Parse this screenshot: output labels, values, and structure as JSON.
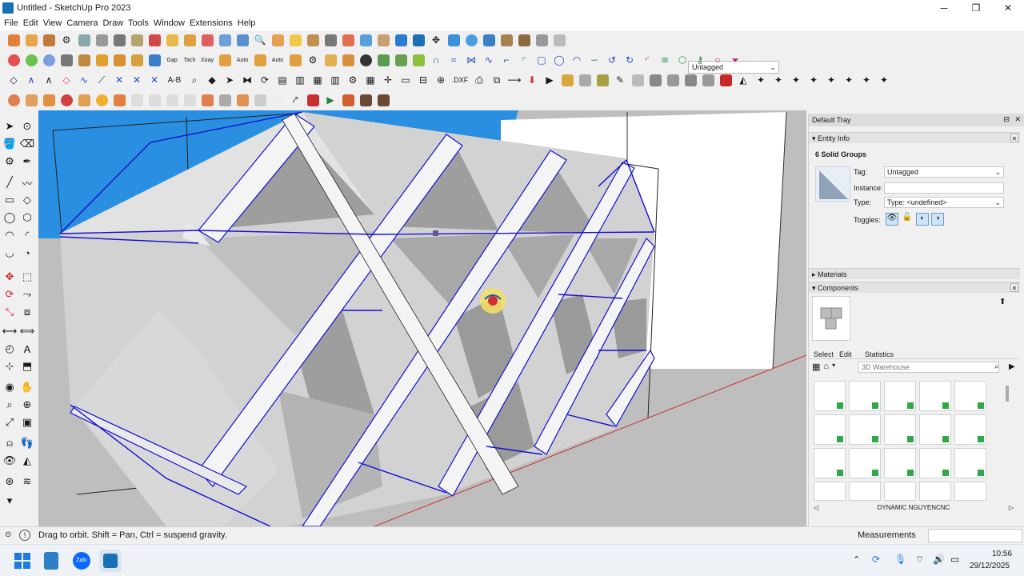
{
  "window": {
    "title": "Untitled - SketchUp Pro 2023",
    "minimize_glyph": "─",
    "maximize_glyph": "❐",
    "close_glyph": "✕"
  },
  "menu": [
    "File",
    "Edit",
    "View",
    "Camera",
    "Draw",
    "Tools",
    "Window",
    "Extensions",
    "Help"
  ],
  "toolbar": {
    "tag_dropdown_value": "Untagged",
    "row2_labels": [
      "Gạp",
      "Tach",
      "Xoay",
      "Auto",
      "Auto"
    ],
    "text_tools": [
      "A-B",
      ".DXF"
    ]
  },
  "tray": {
    "title": "Default Tray",
    "entity_info": {
      "header": "Entity Info",
      "selection": "6 Solid Groups",
      "tag_label": "Tag:",
      "tag_value": "Untagged",
      "instance_label": "Instance:",
      "instance_value": "",
      "type_label": "Type:",
      "type_value": "Type: <undefined>",
      "toggles_label": "Toggles:"
    },
    "materials": {
      "header": "Materials"
    },
    "components": {
      "header": "Components",
      "tabs": [
        "Select",
        "Edit",
        "Statistics"
      ],
      "search_placeholder": "3D Warehouse",
      "collection_name": "DYNAMIC NGUYENCNC"
    }
  },
  "status": {
    "hint": "Drag to orbit. Shift = Pan, Ctrl = suspend gravity.",
    "measurements_label": "Measurements"
  },
  "taskbar": {
    "time": "10:56",
    "date": "29/12/2025"
  },
  "colors": {
    "sky": "#2a8fe0",
    "ground": "#bebebe",
    "edge_selected": "#1010d0",
    "accent": "#1b6fb5"
  }
}
